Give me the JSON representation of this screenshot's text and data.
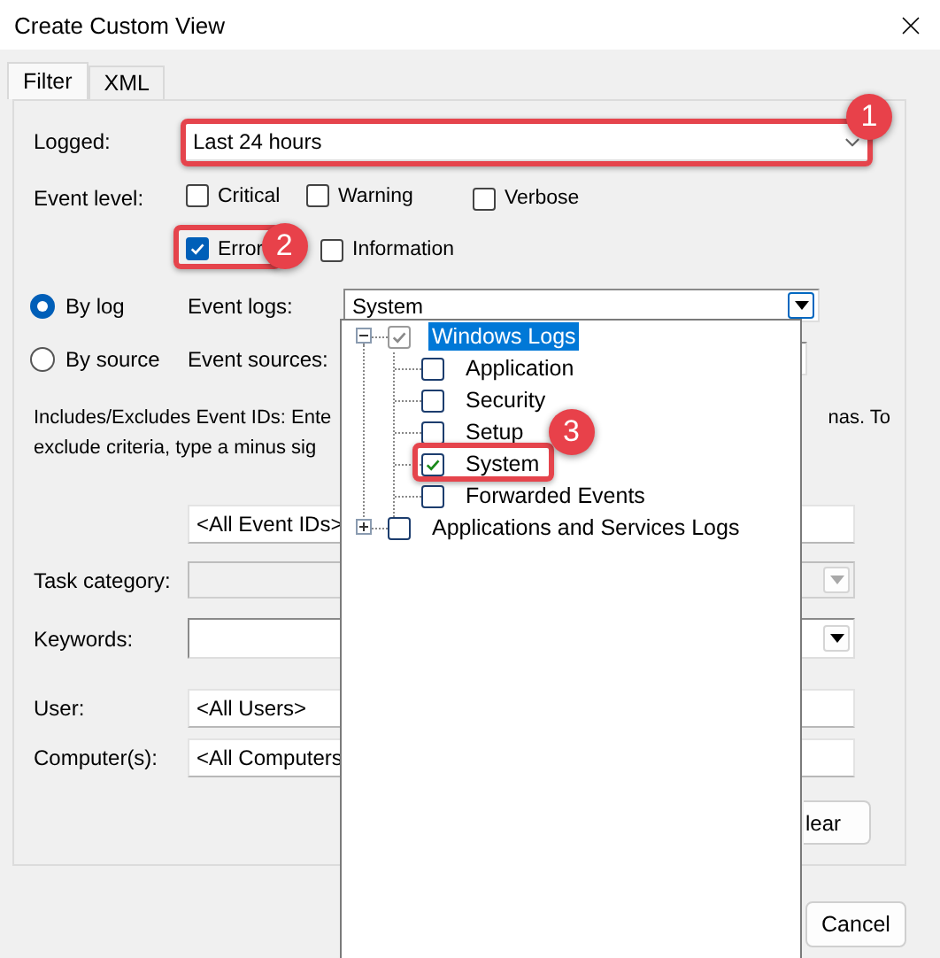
{
  "window": {
    "title": "Create Custom View"
  },
  "tabs": [
    {
      "label": "Filter",
      "selected": true
    },
    {
      "label": "XML",
      "selected": false
    }
  ],
  "logged": {
    "label": "Logged:",
    "value": "Last 24 hours",
    "callout": "1"
  },
  "event_level": {
    "label": "Event level:",
    "levels": [
      {
        "label": "Critical",
        "checked": false
      },
      {
        "label": "Warning",
        "checked": false
      },
      {
        "label": "Verbose",
        "checked": false
      },
      {
        "label": "Error",
        "checked": true,
        "callout": "2"
      },
      {
        "label": "Information",
        "checked": false
      }
    ]
  },
  "sources": [
    {
      "label": "By log",
      "selected": true,
      "field_label": "Event logs:",
      "value": "System"
    },
    {
      "label": "By source",
      "selected": false,
      "field_label": "Event sources:"
    }
  ],
  "description": [
    "Includes/Excludes Event IDs: Ente",
    "nas. To",
    "exclude criteria, type a minus sig"
  ],
  "fields": [
    {
      "kind": "text",
      "value": "<All Event IDs>"
    },
    {
      "kind": "combo",
      "label": "Task category:",
      "disabled": true
    },
    {
      "kind": "combo",
      "label": "Keywords:",
      "disabled": false
    },
    {
      "kind": "text",
      "label": "User:",
      "value": "<All Users>"
    },
    {
      "kind": "text",
      "label": "Computer(s):",
      "value": "<All Computers"
    }
  ],
  "clear_button": "lear",
  "cancel_button": "Cancel",
  "log_tree": [
    {
      "label": "Windows Logs",
      "checked": true,
      "grayed": true,
      "selected": true,
      "expanded": true,
      "children": [
        {
          "label": "Application",
          "checked": false,
          "selected": false
        },
        {
          "label": "Security",
          "checked": false,
          "selected": false
        },
        {
          "label": "Setup",
          "checked": false,
          "selected": false
        },
        {
          "label": "System",
          "checked": true,
          "selected": false,
          "callout": "3"
        },
        {
          "label": "Forwarded Events",
          "checked": false,
          "selected": false
        }
      ]
    },
    {
      "label": "Applications and Services Logs",
      "checked": false,
      "grayed": false,
      "selected": false,
      "expanded": false
    }
  ]
}
